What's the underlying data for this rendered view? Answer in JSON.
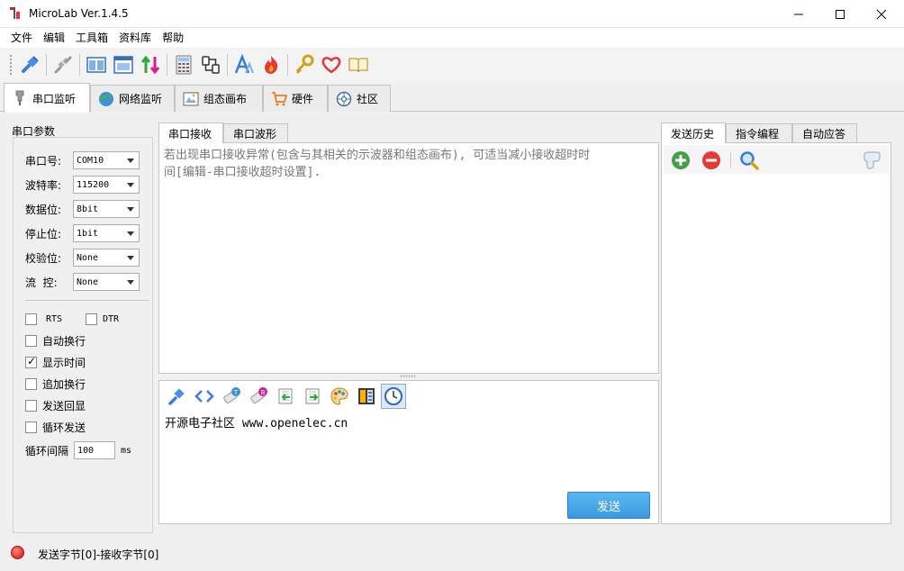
{
  "window": {
    "title": "MicroLab Ver.1.4.5",
    "icon": "microlab-app-icon"
  },
  "menu": [
    "文件",
    "编辑",
    "工具箱",
    "资料库",
    "帮助"
  ],
  "toolbar_icons": [
    "connect-plug-icon",
    "disconnect-plug-icon",
    "split-view-icon",
    "window-view-icon",
    "up-down-arrows-icon",
    "calculator-icon",
    "cable-icon",
    "font-icon",
    "flame-icon",
    "key-icon",
    "heart-icon",
    "book-icon"
  ],
  "main_tabs": [
    {
      "label": "串口监听",
      "icon": "serial-port-icon",
      "active": true
    },
    {
      "label": "网络监听",
      "icon": "globe-icon",
      "active": false
    },
    {
      "label": "组态画布",
      "icon": "canvas-icon",
      "active": false
    },
    {
      "label": "硬件",
      "icon": "cart-icon",
      "active": false
    },
    {
      "label": "社区",
      "icon": "community-icon",
      "active": false
    }
  ],
  "serial_params": {
    "group_title": "串口参数",
    "rows": [
      {
        "label": "串口号:",
        "value": "COM10"
      },
      {
        "label": "波特率:",
        "value": "115200"
      },
      {
        "label": "数据位:",
        "value": "8bit"
      },
      {
        "label": "停止位:",
        "value": "1bit"
      },
      {
        "label": "校验位:",
        "value": "None"
      },
      {
        "label": "流  控:",
        "value": "None"
      }
    ],
    "rts_label": "RTS",
    "dtr_label": "DTR",
    "options": [
      {
        "label": "自动换行",
        "checked": false
      },
      {
        "label": "显示时间",
        "checked": true
      },
      {
        "label": "追加换行",
        "checked": false
      },
      {
        "label": "发送回显",
        "checked": false
      },
      {
        "label": "循环发送",
        "checked": false
      }
    ],
    "interval_label": "循环间隔",
    "interval_value": "100",
    "interval_unit": "ms"
  },
  "receive": {
    "tabs": [
      "串口接收",
      "串口波形"
    ],
    "hint_line1": "若出现串口接收异常(包含与其相关的示波器和组态画布), 可适当减小接收超时时",
    "hint_line2": "间[编辑-串口接收超时设置]."
  },
  "send": {
    "tool_icons": [
      "plug-connect-icon",
      "code-brackets-icon",
      "eraser-t-icon",
      "eraser-b-icon",
      "import-icon",
      "export-icon",
      "palette-icon",
      "led-panel-icon",
      "clock-icon"
    ],
    "text": "开源电子社区 www.openelec.cn",
    "button_label": "发送"
  },
  "history": {
    "tabs": [
      "发送历史",
      "指令编程",
      "自动应答"
    ],
    "tool_icons": [
      "add-icon",
      "remove-icon",
      "search-icon",
      "eraser-icon"
    ]
  },
  "status": {
    "text": "发送字节[0]-接收字节[0]"
  }
}
